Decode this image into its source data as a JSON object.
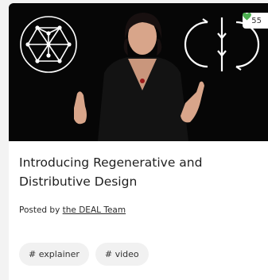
{
  "card": {
    "likes": "55",
    "title": "Introducing Regenerative and Distributive Design",
    "posted_by_prefix": "Posted by",
    "author": "the DEAL Team",
    "tags": [
      "# explainer",
      "# video"
    ]
  },
  "colors": {
    "like_heart": "#4caf50",
    "thumbnail_bg": "#060606",
    "tag_bg": "#f1f1f1"
  },
  "icons": {
    "like": "heart-icon",
    "left_logo": "network-circle-logo",
    "right_logo": "regenerative-distributive-cycle-logo"
  }
}
